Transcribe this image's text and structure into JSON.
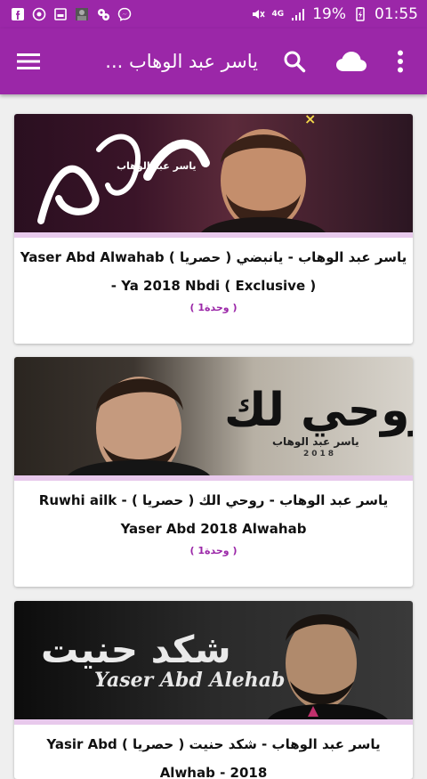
{
  "status_bar": {
    "network": "4G",
    "battery_percent": "19%",
    "time": "01:55",
    "icons": [
      "facebook-icon",
      "gallery-icon",
      "browser-icon",
      "photo-icon",
      "settings-icon",
      "messenger-icon",
      "mute-icon",
      "signal-icon",
      "battery-icon"
    ]
  },
  "app_bar": {
    "title": "ياسر عبد الوهاب ...",
    "icons": [
      "menu-icon",
      "search-icon",
      "cloud-icon",
      "more-icon"
    ]
  },
  "colors": {
    "primary": "#9b27a8",
    "accent_text": "#9b27a8",
    "background": "#efefef"
  },
  "cards": [
    {
      "title": "ياسر عبد الوهاب - يانبضي ( حصريا ) Yaser Abd Alwahab - Ya 2018 Nbdi ( Exclusive )",
      "count": "( 1وحدة )",
      "thumb_text": "ياسر عبد الوهاب"
    },
    {
      "title": "ياسر عبد الوهاب - روحي الك ( حصريا ) Ruwhi ailk - Yaser Abd 2018 Alwahab",
      "count": "( 1وحدة )",
      "thumb_text_main": "روحي لك",
      "thumb_text_sub": "ياسر عبد الوهاب",
      "thumb_year": "2018"
    },
    {
      "title": "ياسر عبد الوهاب - شكد حنيت ( حصريا ) Yasir Abd Alwhab - 2018",
      "count": "",
      "thumb_text_main": "شكد حنيت",
      "thumb_text_sub": "Yaser Abd Alehab"
    }
  ]
}
